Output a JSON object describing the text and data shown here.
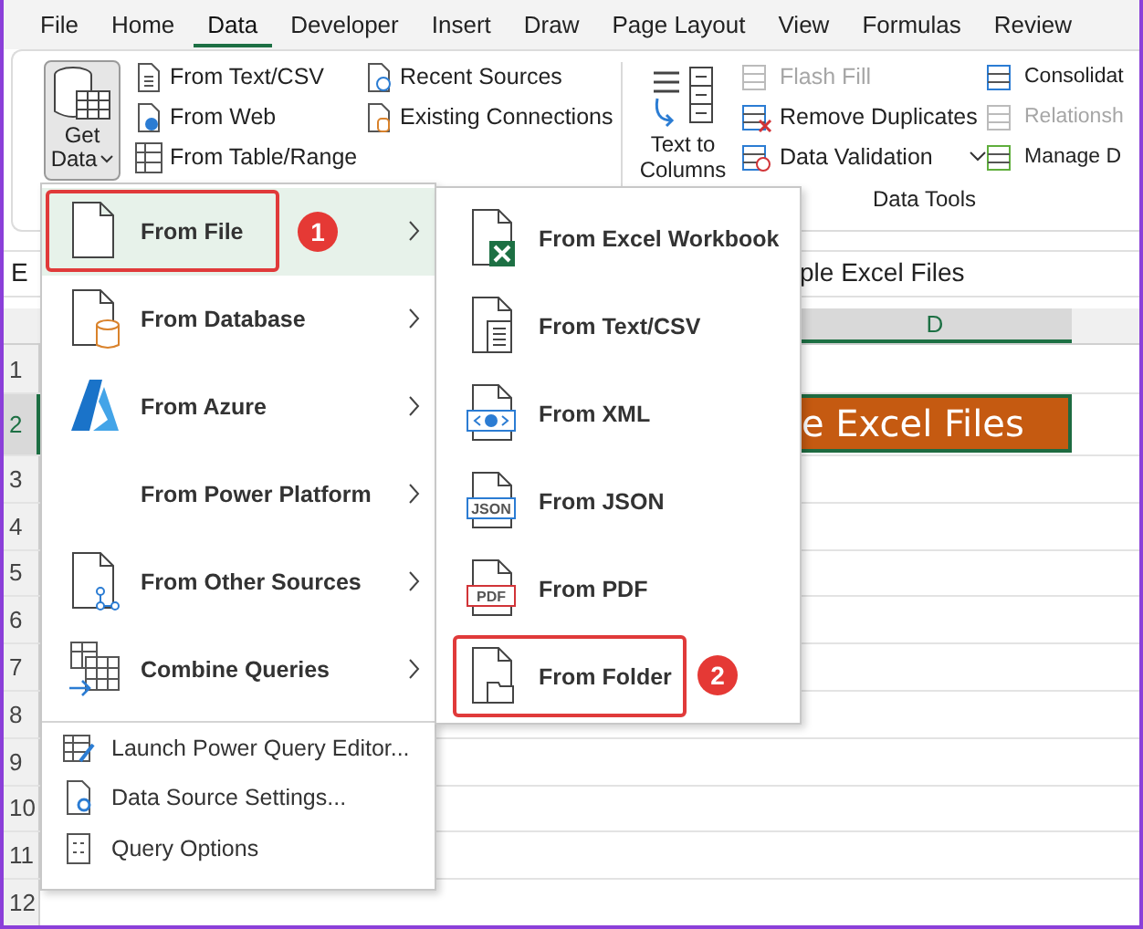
{
  "tabs": [
    {
      "label": "File",
      "selected": false
    },
    {
      "label": "Home",
      "selected": false
    },
    {
      "label": "Data",
      "selected": true
    },
    {
      "label": "Developer",
      "selected": false
    },
    {
      "label": "Insert",
      "selected": false
    },
    {
      "label": "Draw",
      "selected": false
    },
    {
      "label": "Page Layout",
      "selected": false
    },
    {
      "label": "View",
      "selected": false
    },
    {
      "label": "Formulas",
      "selected": false
    },
    {
      "label": "Review",
      "selected": false
    }
  ],
  "ribbon": {
    "get_data": {
      "line1": "Get",
      "line2": "Data",
      "pressed": true
    },
    "sources": [
      [
        {
          "label": "From Text/CSV"
        },
        {
          "label": "From Web"
        },
        {
          "label": "From Table/Range"
        }
      ],
      [
        {
          "label": "Recent Sources"
        },
        {
          "label": "Existing Connections"
        }
      ]
    ],
    "text_to_columns": {
      "line1": "Text to",
      "line2": "Columns"
    },
    "tools": [
      [
        {
          "label": "Flash Fill",
          "disabled": true,
          "dropdown": false
        },
        {
          "label": "Remove Duplicates",
          "disabled": false,
          "dropdown": false
        },
        {
          "label": "Data Validation",
          "disabled": false,
          "dropdown": true
        }
      ],
      [
        {
          "label": "Consolidat",
          "disabled": false,
          "dropdown": false
        },
        {
          "label": "Relationsh",
          "disabled": true,
          "dropdown": false
        },
        {
          "label": "Manage D",
          "disabled": false,
          "dropdown": false
        }
      ]
    ],
    "group_label": "Data Tools"
  },
  "name_box": "E",
  "formula": "ple Excel Files",
  "column_header": {
    "label": "D",
    "selected": true
  },
  "rows": [
    {
      "label": "1",
      "selected": false
    },
    {
      "label": "2",
      "selected": true
    },
    {
      "label": "3",
      "selected": false
    },
    {
      "label": "4",
      "selected": false
    },
    {
      "label": "5",
      "selected": false
    },
    {
      "label": "6",
      "selected": false
    },
    {
      "label": "7",
      "selected": false
    },
    {
      "label": "8",
      "selected": false
    },
    {
      "label": "9",
      "selected": false
    },
    {
      "label": "10",
      "selected": false
    },
    {
      "label": "11",
      "selected": false
    },
    {
      "label": "12",
      "selected": false
    }
  ],
  "cell_text": "e Excel Files",
  "menu": {
    "items": [
      {
        "label": "From File",
        "kind": "large",
        "submenu": true,
        "selected": true,
        "callout": "1"
      },
      {
        "label": "From Database",
        "kind": "large",
        "submenu": true,
        "selected": false
      },
      {
        "label": "From Azure",
        "kind": "large",
        "submenu": true,
        "selected": false
      },
      {
        "label": "From Power Platform",
        "kind": "large",
        "submenu": true,
        "selected": false
      },
      {
        "label": "From Other Sources",
        "kind": "large",
        "submenu": true,
        "selected": false
      },
      {
        "label": "Combine Queries",
        "kind": "large",
        "submenu": true,
        "selected": false
      },
      {
        "label": "Launch Power Query Editor...",
        "kind": "small",
        "submenu": false,
        "selected": false
      },
      {
        "label": "Data Source Settings...",
        "kind": "small",
        "submenu": false,
        "selected": false
      },
      {
        "label": "Query Options",
        "kind": "small",
        "submenu": false,
        "selected": false
      }
    ]
  },
  "submenu": {
    "items": [
      {
        "label": "From Excel Workbook"
      },
      {
        "label": "From Text/CSV"
      },
      {
        "label": "From XML"
      },
      {
        "label": "From JSON",
        "icon_text": "JSON"
      },
      {
        "label": "From PDF",
        "icon_text": "PDF"
      },
      {
        "label": "From Folder",
        "callout": "2"
      }
    ]
  }
}
